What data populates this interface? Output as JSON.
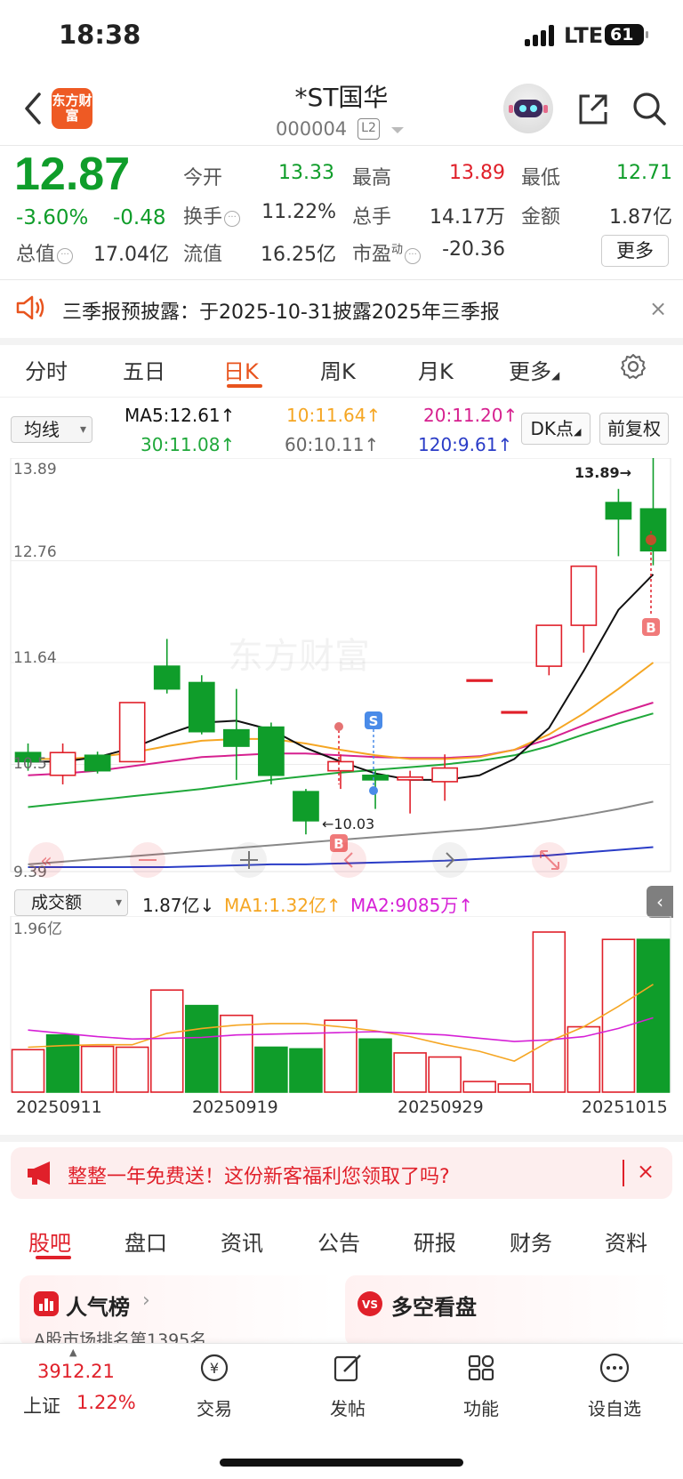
{
  "status": {
    "time": "18:38",
    "network": "LTE",
    "battery": "61"
  },
  "header": {
    "logo_text": "东方财富",
    "name": "*ST国华",
    "code": "000004",
    "level": "L2"
  },
  "quote": {
    "price": "12.87",
    "change_pct": "-3.60%",
    "change": "-0.48",
    "fields": [
      {
        "label": "今开",
        "value": "13.33"
      },
      {
        "label": "最高",
        "value": "13.89"
      },
      {
        "label": "最低",
        "value": "12.71"
      },
      {
        "label": "换手",
        "value": "11.22%"
      },
      {
        "label": "总手",
        "value": "14.17万"
      },
      {
        "label": "金额",
        "value": "1.87亿"
      },
      {
        "label": "总值",
        "value": "17.04亿"
      },
      {
        "label": "流值",
        "value": "16.25亿"
      },
      {
        "label": "市盈",
        "value": "-20.36"
      }
    ],
    "pe_suffix": "动",
    "more": "更多"
  },
  "notice": {
    "text": "三季报预披露：于2025-10-31披露2025年三季报",
    "close": "×"
  },
  "period_tabs": [
    "分时",
    "五日",
    "日K",
    "周K",
    "月K",
    "更多"
  ],
  "active_period": "日K",
  "ma": {
    "selector": "均线",
    "ma5": "MA5:12.61↑",
    "ma10": "10:11.64↑",
    "ma20": "20:11.20↑",
    "ma30": "30:11.08↑",
    "ma60": "60:10.11↑",
    "ma120": "120:9.61↑",
    "dk_button": "DK点",
    "adj_button": "前复权"
  },
  "colors": {
    "up": "#e0202a",
    "down": "#0f9d2a",
    "ma5": "#111111",
    "ma10": "#f5a623",
    "ma20": "#d6208f",
    "ma30": "#1fa83a",
    "ma60": "#888888",
    "ma120": "#2a3cc7"
  },
  "chart_labels": {
    "y_top": "13.89",
    "y_mid1": "12.76",
    "y_mid2": "11.64",
    "y_mid3": "10.5",
    "y_bottom": "9.39",
    "max_marker": "13.89→",
    "min_marker": "←10.03",
    "watermark": "东方财富",
    "sell_flag": "S",
    "buy_flag": "B"
  },
  "volume": {
    "selector": "成交额",
    "current": "1.87亿↓",
    "ma1": "MA1:1.32亿↑",
    "ma2": "MA2:9085万↑",
    "y_top": "1.96亿"
  },
  "dates": [
    "20250911",
    "20250919",
    "20250929",
    "20251015"
  ],
  "chart_data": {
    "type": "candlestick",
    "ylim": [
      9.39,
      13.89
    ],
    "candles": [
      {
        "o": 10.65,
        "c": 10.55,
        "h": 10.75,
        "l": 10.45
      },
      {
        "o": 10.4,
        "c": 10.65,
        "h": 10.75,
        "l": 10.3
      },
      {
        "o": 10.62,
        "c": 10.45,
        "h": 10.66,
        "l": 10.42
      },
      {
        "o": 10.55,
        "c": 11.2,
        "h": 11.2,
        "l": 10.55
      },
      {
        "o": 11.6,
        "c": 11.35,
        "h": 11.9,
        "l": 11.3
      },
      {
        "o": 11.42,
        "c": 10.88,
        "h": 11.5,
        "l": 10.85
      },
      {
        "o": 10.9,
        "c": 10.72,
        "h": 11.35,
        "l": 10.35
      },
      {
        "o": 10.93,
        "c": 10.4,
        "h": 10.98,
        "l": 10.3
      },
      {
        "o": 10.22,
        "c": 9.9,
        "h": 10.25,
        "l": 9.75
      },
      {
        "o": 10.45,
        "c": 10.55,
        "h": 10.63,
        "l": 10.25
      },
      {
        "o": 10.4,
        "c": 10.35,
        "h": 10.45,
        "l": 10.03
      },
      {
        "o": 10.35,
        "c": 10.38,
        "h": 10.45,
        "l": 9.98
      },
      {
        "o": 10.33,
        "c": 10.48,
        "h": 10.63,
        "l": 10.12
      },
      {
        "o": 11.45,
        "c": 11.45,
        "h": 11.45,
        "l": 11.45
      },
      {
        "o": 11.1,
        "c": 11.1,
        "h": 11.1,
        "l": 11.1
      },
      {
        "o": 11.6,
        "c": 12.05,
        "h": 12.05,
        "l": 11.5
      },
      {
        "o": 12.05,
        "c": 12.7,
        "h": 12.7,
        "l": 11.75
      },
      {
        "o": 13.4,
        "c": 13.22,
        "h": 13.55,
        "l": 12.81
      },
      {
        "o": 13.33,
        "c": 12.87,
        "h": 13.89,
        "l": 12.71
      }
    ],
    "ma5": [
      10.55,
      10.55,
      10.6,
      10.7,
      10.85,
      10.98,
      11.0,
      10.9,
      10.7,
      10.55,
      10.42,
      10.35,
      10.35,
      10.4,
      10.58,
      10.92,
      11.55,
      12.22,
      12.61
    ],
    "ma10": [
      10.58,
      10.58,
      10.6,
      10.65,
      10.72,
      10.78,
      10.8,
      10.8,
      10.75,
      10.68,
      10.62,
      10.58,
      10.58,
      10.6,
      10.68,
      10.85,
      11.08,
      11.35,
      11.64
    ],
    "ma20": [
      10.4,
      10.42,
      10.45,
      10.5,
      10.55,
      10.6,
      10.62,
      10.64,
      10.64,
      10.62,
      10.6,
      10.59,
      10.59,
      10.61,
      10.68,
      10.8,
      10.95,
      11.08,
      11.2
    ],
    "ma30": [
      10.05,
      10.09,
      10.13,
      10.17,
      10.21,
      10.25,
      10.3,
      10.35,
      10.39,
      10.43,
      10.46,
      10.49,
      10.52,
      10.56,
      10.62,
      10.72,
      10.85,
      10.97,
      11.08
    ],
    "ma60": [
      9.42,
      9.45,
      9.48,
      9.51,
      9.54,
      9.57,
      9.6,
      9.63,
      9.66,
      9.69,
      9.72,
      9.75,
      9.78,
      9.81,
      9.85,
      9.9,
      9.96,
      10.03,
      10.11
    ],
    "ma120": [
      9.39,
      9.39,
      9.39,
      9.39,
      9.39,
      9.4,
      9.41,
      9.42,
      9.42,
      9.43,
      9.44,
      9.45,
      9.46,
      9.48,
      9.5,
      9.52,
      9.55,
      9.58,
      9.61
    ],
    "volume": {
      "unit": "亿",
      "ylim": [
        0,
        1.96
      ],
      "values": [
        0.52,
        0.7,
        0.56,
        0.55,
        1.25,
        1.06,
        0.94,
        0.55,
        0.53,
        0.88,
        0.65,
        0.48,
        0.43,
        0.13,
        0.1,
        1.96,
        0.8,
        1.87,
        1.87
      ],
      "direction": [
        "up",
        "down",
        "up",
        "up",
        "up",
        "down",
        "up",
        "down",
        "down",
        "up",
        "down",
        "up",
        "up",
        "up",
        "up",
        "up",
        "up",
        "up",
        "down"
      ],
      "ma1": [
        0.55,
        0.57,
        0.58,
        0.58,
        0.72,
        0.78,
        0.82,
        0.84,
        0.84,
        0.8,
        0.75,
        0.68,
        0.58,
        0.5,
        0.38,
        0.62,
        0.8,
        1.05,
        1.32
      ],
      "ma2": [
        0.76,
        0.72,
        0.68,
        0.65,
        0.66,
        0.67,
        0.7,
        0.71,
        0.72,
        0.73,
        0.74,
        0.72,
        0.7,
        0.66,
        0.62,
        0.64,
        0.68,
        0.78,
        0.91
      ]
    }
  },
  "promo": {
    "text": "整整一年免费送！这份新客福利您领取了吗?",
    "close": "×"
  },
  "bottom_tabs": [
    "股吧",
    "盘口",
    "资讯",
    "公告",
    "研报",
    "财务",
    "资料"
  ],
  "cards": [
    {
      "title": "人气榜",
      "sub": "A股市场排名第1395名"
    },
    {
      "title": "多空看盘",
      "sub": ""
    }
  ],
  "index": {
    "value": "3912.21",
    "name": "上证",
    "pct": "1.22%"
  },
  "nav": [
    "交易",
    "发帖",
    "功能",
    "设自选"
  ]
}
